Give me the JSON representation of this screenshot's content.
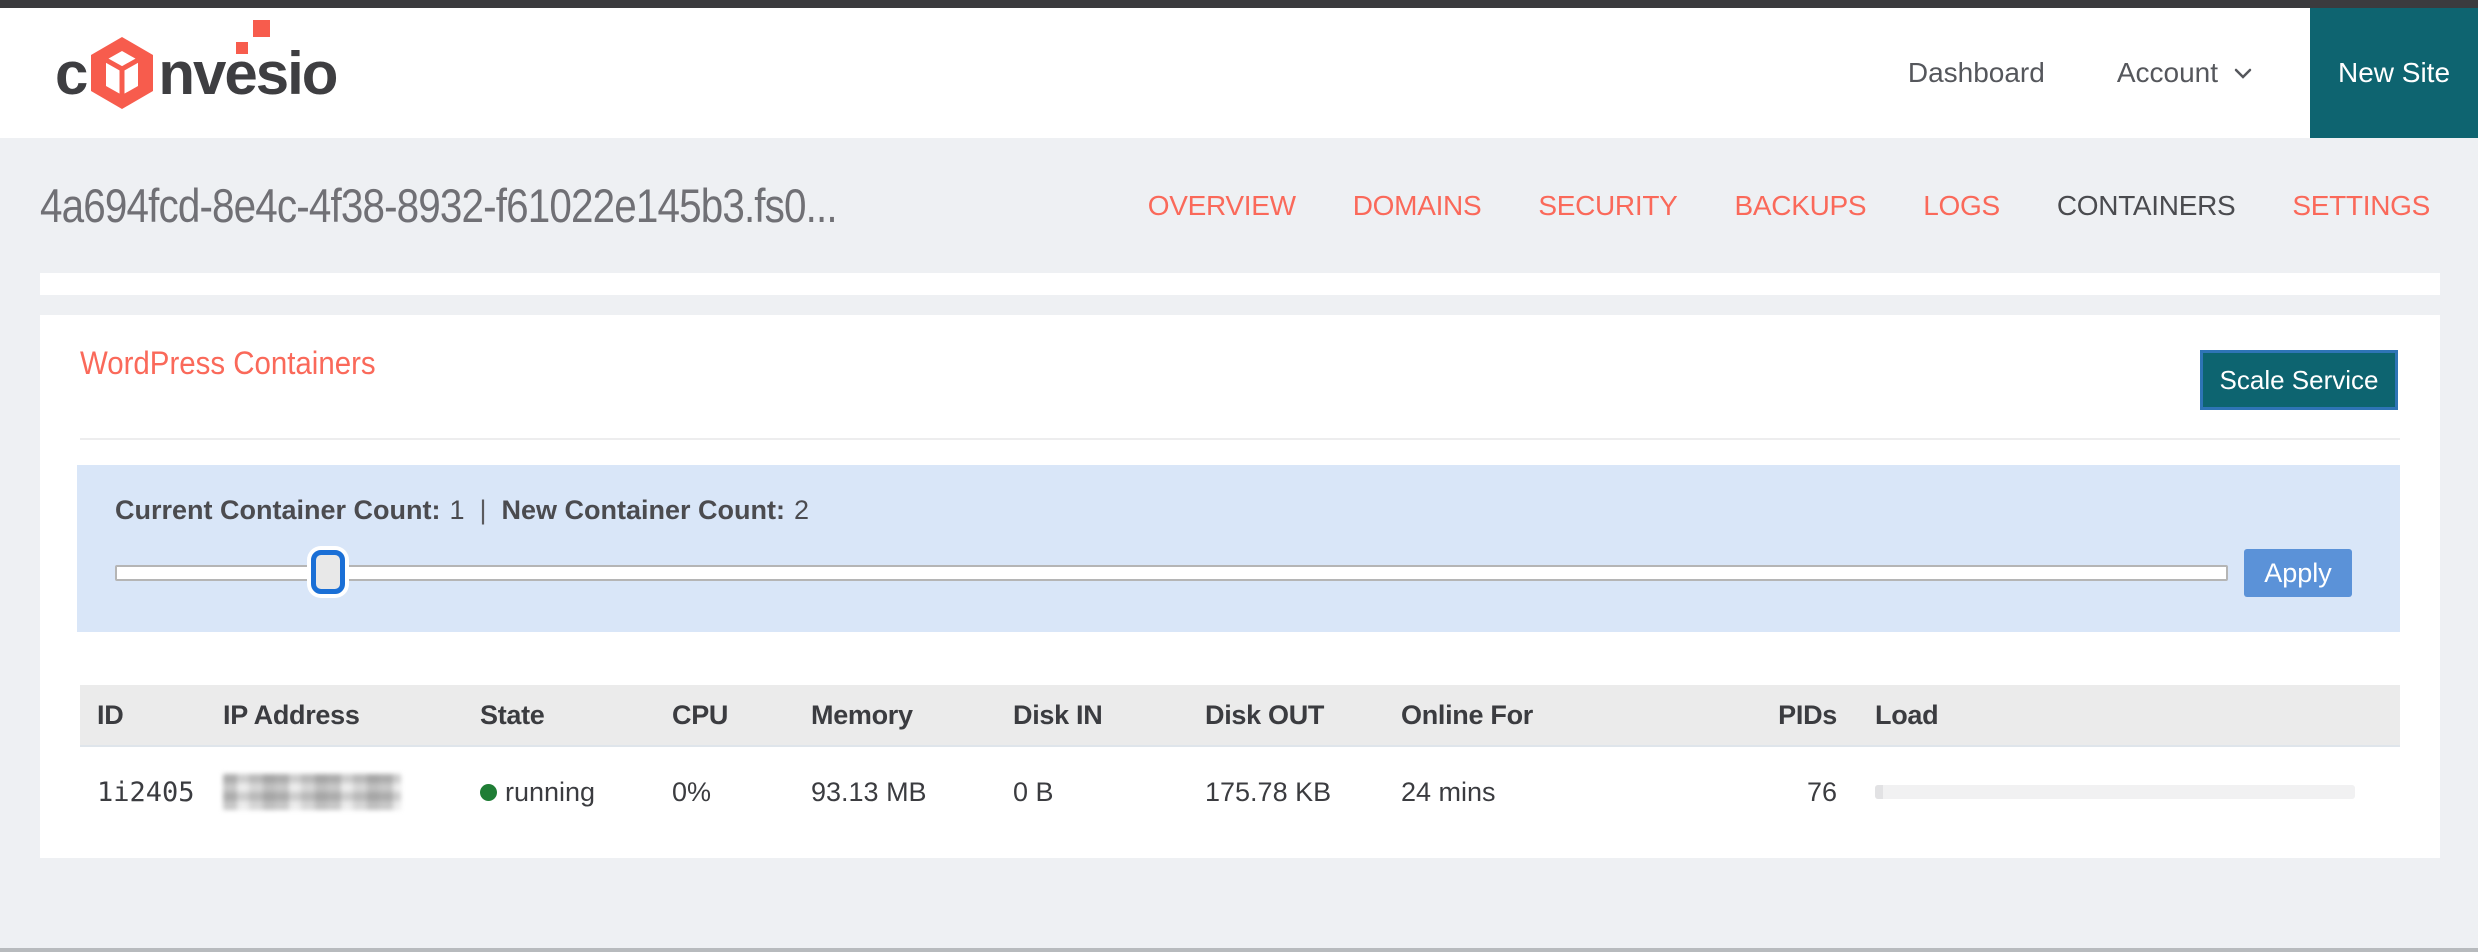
{
  "header": {
    "logo": {
      "pre": "c",
      "post": "nvesio"
    },
    "nav": {
      "dashboard": "Dashboard",
      "account": "Account"
    },
    "new_site_label": "New Site"
  },
  "site": {
    "title": "4a694fcd-8e4c-4f38-8932-f61022e145b3.fs0...",
    "tabs": [
      {
        "label": "OVERVIEW",
        "active": false
      },
      {
        "label": "DOMAINS",
        "active": false
      },
      {
        "label": "SECURITY",
        "active": false
      },
      {
        "label": "BACKUPS",
        "active": false
      },
      {
        "label": "LOGS",
        "active": false
      },
      {
        "label": "CONTAINERS",
        "active": true
      },
      {
        "label": "SETTINGS",
        "active": false
      }
    ]
  },
  "panel": {
    "heading": "WordPress Containers",
    "scale_button_label": "Scale Service",
    "scaler": {
      "current_label": "Current Container Count:",
      "current_value": "1",
      "separator": "|",
      "new_label": "New Container Count:",
      "new_value": "2",
      "slider_percent": 10,
      "apply_label": "Apply"
    },
    "table": {
      "columns": [
        "ID",
        "IP Address",
        "State",
        "CPU",
        "Memory",
        "Disk IN",
        "Disk OUT",
        "Online For",
        "PIDs",
        "Load"
      ],
      "row": {
        "id": "1i2405",
        "ip_blurred": true,
        "state": "running",
        "cpu": "0%",
        "memory": "93.13 MB",
        "disk_in": "0 B",
        "disk_out": "175.78 KB",
        "online_for": "24 mins",
        "pids": "76"
      }
    }
  },
  "colors": {
    "coral": "#fa695a",
    "logo_coral": "#f75c4d",
    "teal": "#0e6470",
    "apply_blue": "#5b92d8",
    "info_box_bg": "#d9e6f8",
    "running_green": "#1f7d35",
    "slider_thumb_border": "#1a6fd6",
    "page_bg": "#eef0f3",
    "header_row_bg": "#ebebeb",
    "top_strip": "#3b3b3e"
  }
}
